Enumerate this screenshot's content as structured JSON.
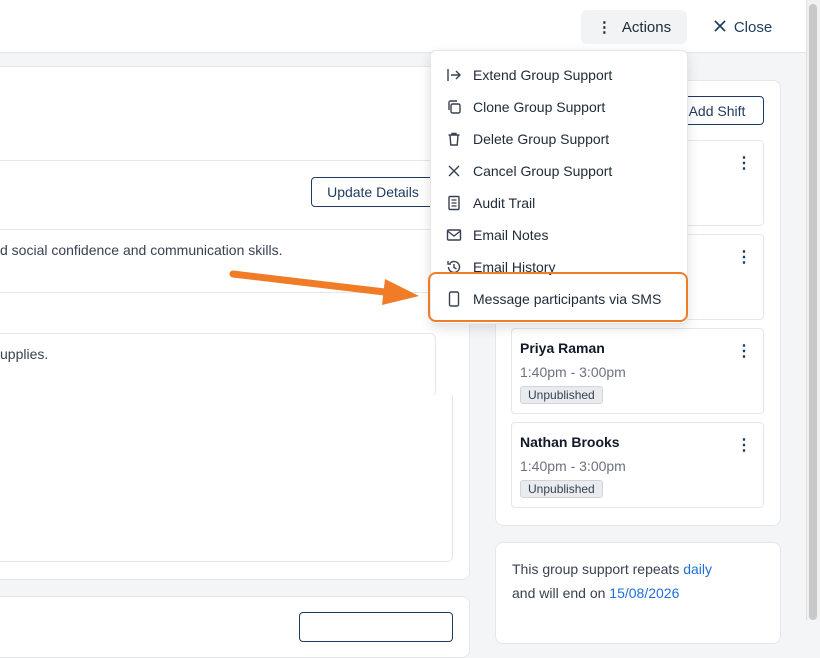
{
  "header": {
    "actions_label": "Actions",
    "close_label": "Close"
  },
  "main": {
    "update_details_label": "Update Details",
    "text_line_1": "d social confidence and communication skills.",
    "text_line_2": "upplies."
  },
  "shifts": {
    "add_shift_label": "Add Shift",
    "items": [
      {
        "name": "Priya Raman",
        "time": "1:40pm - 3:00pm",
        "status": "Unpublished"
      },
      {
        "name": "Nathan Brooks",
        "time": "1:40pm - 3:00pm",
        "status": "Unpublished"
      }
    ]
  },
  "repeat": {
    "line1_prefix": "This group support repeats",
    "frequency": "daily",
    "line2_prefix": "and will end on",
    "end_date": "15/08/2026"
  },
  "menu": {
    "items": [
      {
        "label": "Extend Group Support",
        "icon": "arrow-right-to-line-icon"
      },
      {
        "label": "Clone Group Support",
        "icon": "copy-icon"
      },
      {
        "label": "Delete Group Support",
        "icon": "trash-icon"
      },
      {
        "label": "Cancel Group Support",
        "icon": "x-icon"
      },
      {
        "label": "Audit Trail",
        "icon": "document-icon"
      },
      {
        "label": "Email Notes",
        "icon": "mail-icon"
      },
      {
        "label": "Email History",
        "icon": "history-icon"
      },
      {
        "label": "Message participants via SMS",
        "icon": "phone-icon"
      }
    ]
  },
  "colors": {
    "accent": "#1f3a5f",
    "highlight": "#f07c28",
    "link": "#1d6fdc"
  }
}
